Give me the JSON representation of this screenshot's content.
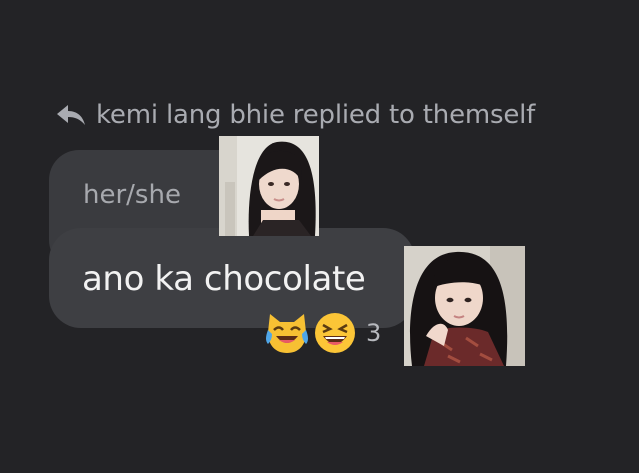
{
  "reply": {
    "header": "kemi lang bhie replied to themself",
    "icon": "reply-arrow-icon"
  },
  "quoted_message": {
    "text": "her/she"
  },
  "message": {
    "text": "ano ka chocolate"
  },
  "reactions": {
    "emojis": [
      "crying-laughing-cat-emoji",
      "laughing-face-emoji"
    ],
    "count": "3"
  },
  "colors": {
    "background": "#232326",
    "bubble": "#3e3f43",
    "muted_text": "#a9abb1",
    "message_text": "#f2f2f2"
  }
}
